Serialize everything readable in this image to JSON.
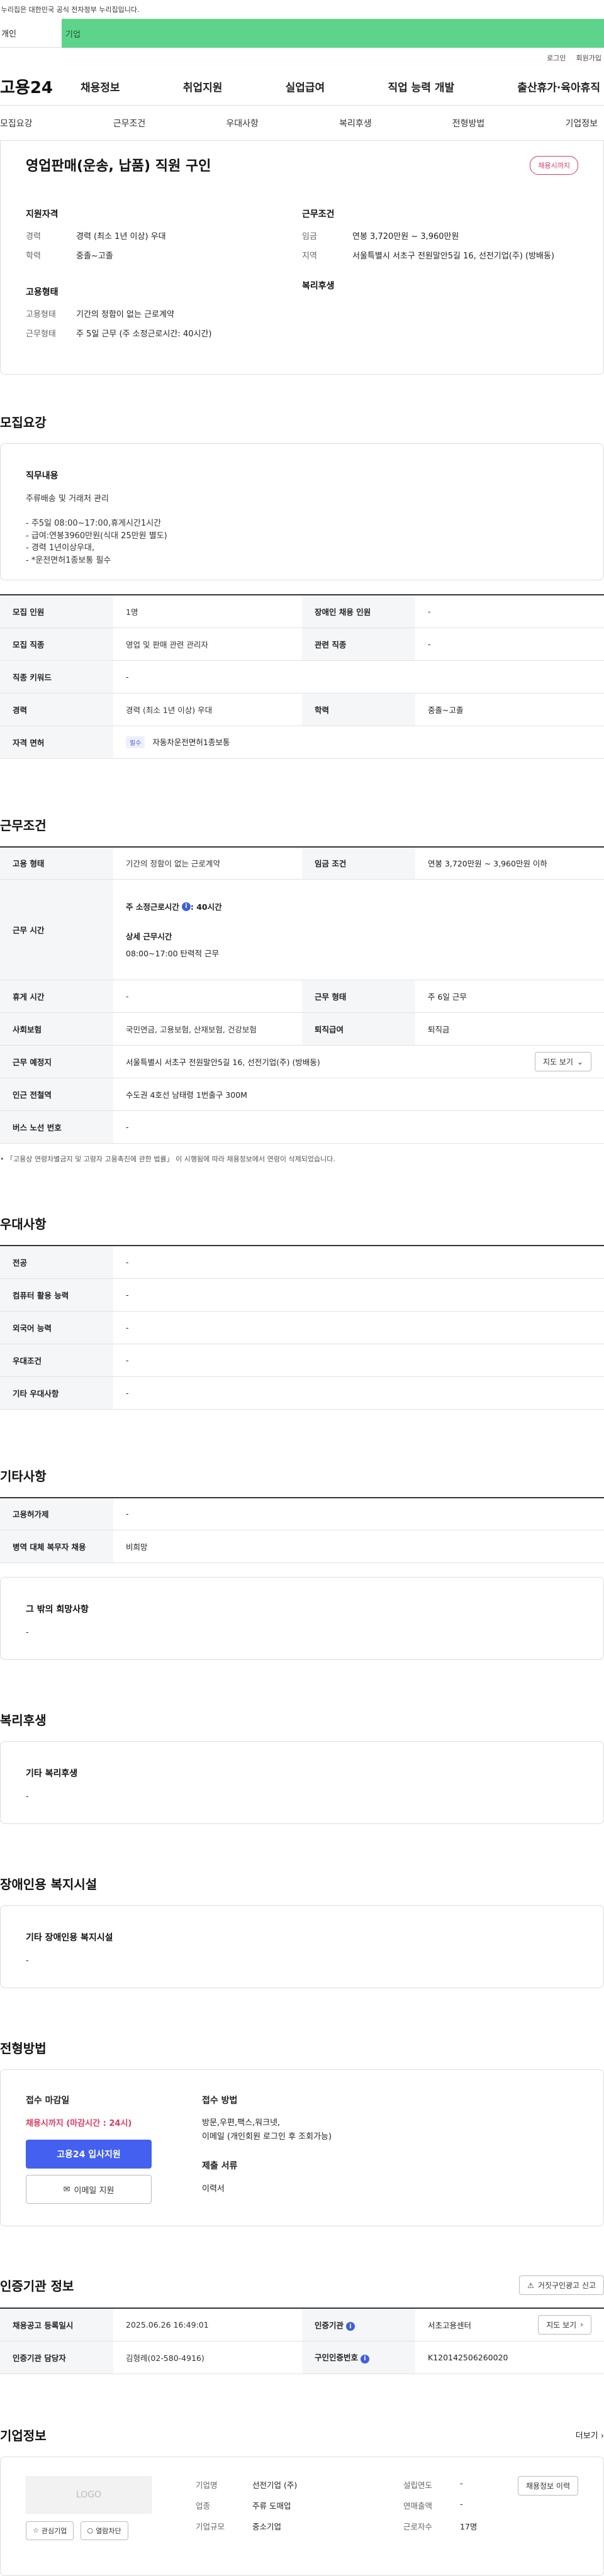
{
  "gov_bar": {
    "text": "이 누리집은 대한민국 공식 전자정부 누리집입니다."
  },
  "top_tabs": {
    "tab1": "개인",
    "tab2": "기업"
  },
  "util": {
    "login": "로그인",
    "join": "회원가입"
  },
  "gnb": {
    "logo": "고용24",
    "menu": [
      "채용정보",
      "취업지원",
      "실업급여",
      "직업 능력 개발",
      "출산휴가·육아휴직"
    ]
  },
  "snb": [
    "모집요강",
    "근무조건",
    "우대사항",
    "복리후생",
    "전형방법",
    "기업정보"
  ],
  "summary": {
    "title": "영업판매(운송, 납품) 직원 구인",
    "badge": "채용시까지",
    "qual_label": "지원자격",
    "career_k": "경력",
    "career_v": "경력 (최소 1년 이상) 우대",
    "edu_k": "학력",
    "edu_v": "중졸~고졸",
    "emp_label": "고용형태",
    "emptype_k": "고용형태",
    "emptype_v": "기간의 정함이 없는 근로계약",
    "worktype_k": "근무형태",
    "worktype_v": "주 5일 근무 (주 소정근로시간: 40시간)",
    "cond_label": "근무조건",
    "wage_k": "임금",
    "wage_v": "연봉 3,720만원 ~ 3,960만원",
    "region_k": "지역",
    "region_v": "서울특별시 서초구 전원말안5길 16, 선전기업(주) (방배동)",
    "welfare_label": "복리후생"
  },
  "recruit": {
    "heading": "모집요강",
    "duty_label": "직무내용",
    "duty_text": "주류배송 및 거래처 관리\n\n- 주5일 08:00~17:00,휴게시간1시간\n- 급여:연봉3960만원(식대 25만원 별도)\n- 경력 1년이상우대,\n- *운전면허1종보통 필수",
    "rows": {
      "count_k": "모집 인원",
      "count_v": "1명",
      "disabled_k": "장애인 채용 인원",
      "disabled_v": "-",
      "job_k": "모집 직종",
      "job_v": "영업 및 판매 관련 관리자",
      "related_k": "관련 직종",
      "related_v": "-",
      "keyword_k": "직종 키워드",
      "keyword_v": "-",
      "career_k": "경력",
      "career_v": "경력 (최소 1년 이상) 우대",
      "edu_k": "학력",
      "edu_v": "중졸~고졸",
      "license_k": "자격 면허",
      "license_chip": "필수",
      "license_v": "자동차운전면허1종보통"
    }
  },
  "conditions": {
    "heading": "근무조건",
    "emptype_k": "고용 형태",
    "emptype_v": "기간의 정함이 없는 근로계약",
    "wage_k": "임금 조건",
    "wage_v": "연봉 3,720만원 ~ 3,960만원 이하",
    "hours_k": "근무 시간",
    "hours_main": "주 소정근로시간",
    "hours_main_v": ": 40시간",
    "hours_detail_label": "상세 근무시간",
    "hours_detail_v": "08:00~17:00 탄력적 근무",
    "break_k": "휴게 시간",
    "break_v": "-",
    "worktype_k": "근무 형태",
    "worktype_v": "주 6일 근무",
    "insurance_k": "사회보험",
    "insurance_v": "국민연금, 고용보험, 산재보험, 건강보험",
    "severance_k": "퇴직급여",
    "severance_v": "퇴직금",
    "place_k": "근무 예정지",
    "place_v": "서울특별시 서초구 전원말안5길 16, 선전기업(주) (방배동)",
    "map_btn": "지도 보기",
    "station_k": "인근 전철역",
    "station_v": "수도권 4호선 남태령 1번출구 300M",
    "bus_k": "버스 노선 번호",
    "bus_v": "-",
    "note": "「고용상 연령차별금지 및 고령자 고용촉진에 관한 법률」 이 시행됨에 따라 채용정보에서 연령이 삭제되었습니다."
  },
  "preference": {
    "heading": "우대사항",
    "major_k": "전공",
    "major_v": "-",
    "computer_k": "컴퓨터 활용 능력",
    "computer_v": "-",
    "lang_k": "외국어 능력",
    "lang_v": "-",
    "pref_k": "우대조건",
    "pref_v": "-",
    "etc_k": "기타 우대사항",
    "etc_v": "-"
  },
  "other": {
    "heading": "기타사항",
    "subsidy_k": "고용허가제",
    "subsidy_v": "-",
    "military_k": "병역 대체 복무자 채용",
    "military_v": "비희망",
    "wish_label": "그 밖의 희망사항",
    "wish_v": "-"
  },
  "welfare": {
    "heading": "복리후생",
    "label": "기타 복리후생",
    "value": "-"
  },
  "disabled_facility": {
    "heading": "장애인용 복지시설",
    "label": "기타 장애인용 복지시설",
    "value": "-"
  },
  "selection": {
    "heading": "전형방법",
    "deadline_label": "접수 마감일",
    "deadline_v": "채용시까지 (마감시간 : 24시)",
    "apply_btn": "고용24 입사지원",
    "email_btn": "이메일 지원",
    "method_label": "접수 방법",
    "method_v": "방문,우편,팩스,워크넷,\n이메일 (개인회원 로그인 후 조회가능)",
    "docs_label": "제출 서류",
    "docs_v": "이력서"
  },
  "agency": {
    "heading": "인증기관 정보",
    "report_btn": "거짓구인광고 신고",
    "reg_k": "채용공고 등록일시",
    "reg_v": "2025.06.26 16:49:01",
    "agency_k": "인증기관",
    "agency_v": "서초고용센터",
    "map_btn": "지도 보기",
    "staff_k": "인증기관 담당자",
    "staff_v": "김형례(02-580-4916)",
    "reqno_k": "구인인증번호",
    "reqno_v": "K120142506260020"
  },
  "company": {
    "heading": "기업정보",
    "more": "더보기",
    "logo": "LOGO",
    "fav_btn": "관심기업",
    "block_btn": "열람차단",
    "name_k": "기업명",
    "name_v": "선전기업 (주)",
    "found_k": "설립연도",
    "found_v": "-",
    "industry_k": "업종",
    "industry_v": "주류 도매업",
    "revenue_k": "연매출액",
    "revenue_v": "-",
    "size_k": "기업규모",
    "size_v": "중소기업",
    "staff_k": "근로자수",
    "staff_v": "17명",
    "history_btn": "채용정보 이력"
  }
}
